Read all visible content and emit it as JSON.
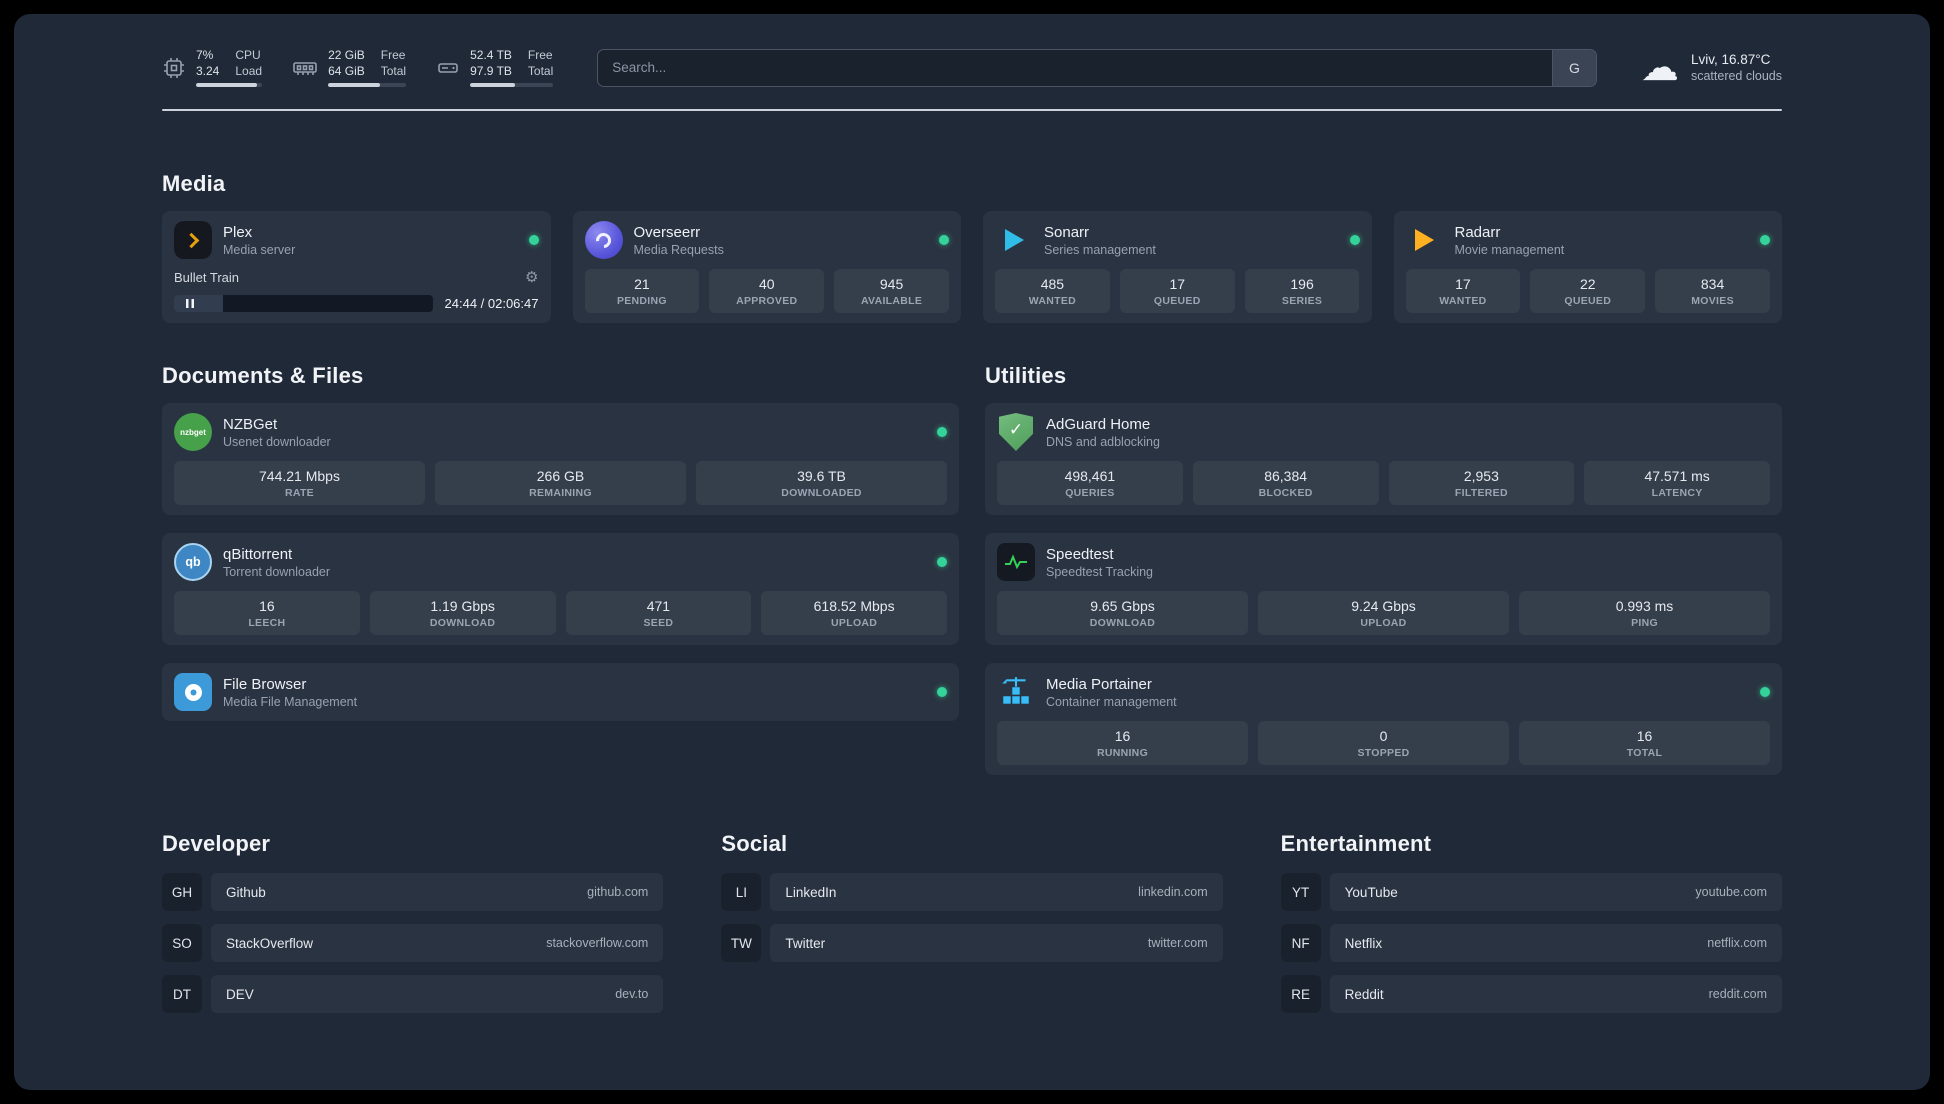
{
  "colors": {
    "background": "#1f2937",
    "card": "rgba(255,255,255,0.05)",
    "status_online": "#34d399",
    "accent_plex": "#e5a00d",
    "accent_sonarr": "#2fbde8",
    "accent_radarr": "#ffb020",
    "accent_adguard": "#4e9d5b",
    "accent_portainer": "#38bdf8",
    "accent_speedtest": "#34d058"
  },
  "icons": [
    "cpu-icon",
    "memory-icon",
    "disk-icon",
    "cloud-icon",
    "gear-icon",
    "pause-icon",
    "plex-icon",
    "overseerr-icon",
    "sonarr-icon",
    "radarr-icon",
    "nzbget-icon",
    "qbittorrent-icon",
    "filebrowser-icon",
    "adguard-shield-icon",
    "speedtest-icon",
    "portainer-icon"
  ],
  "topbar": {
    "resources": [
      {
        "icon": "cpu-icon",
        "col1_top": "7%",
        "col1_bottom": "3.24",
        "col2_top": "CPU",
        "col2_bottom": "Load",
        "progress": 93
      },
      {
        "icon": "memory-icon",
        "col1_top": "22 GiB",
        "col1_bottom": "64 GiB",
        "col2_top": "Free",
        "col2_bottom": "Total",
        "progress": 66
      },
      {
        "icon": "disk-icon",
        "col1_top": "52.4 TB",
        "col1_bottom": "97.9 TB",
        "col2_top": "Free",
        "col2_bottom": "Total",
        "progress": 54
      }
    ],
    "search": {
      "placeholder": "Search...",
      "provider_label": "G"
    },
    "weather": {
      "location": "Lviv, 16.87°C",
      "condition": "scattered clouds"
    }
  },
  "media": {
    "title": "Media",
    "plex": {
      "name": "Plex",
      "subtitle": "Media server",
      "track": "Bullet Train",
      "time": "24:44 / 02:06:47",
      "progress": 19
    },
    "overseerr": {
      "name": "Overseerr",
      "subtitle": "Media Requests",
      "stats": [
        {
          "value": "21",
          "label": "PENDING"
        },
        {
          "value": "40",
          "label": "APPROVED"
        },
        {
          "value": "945",
          "label": "AVAILABLE"
        }
      ]
    },
    "sonarr": {
      "name": "Sonarr",
      "subtitle": "Series management",
      "stats": [
        {
          "value": "485",
          "label": "WANTED"
        },
        {
          "value": "17",
          "label": "QUEUED"
        },
        {
          "value": "196",
          "label": "SERIES"
        }
      ]
    },
    "radarr": {
      "name": "Radarr",
      "subtitle": "Movie management",
      "stats": [
        {
          "value": "17",
          "label": "WANTED"
        },
        {
          "value": "22",
          "label": "QUEUED"
        },
        {
          "value": "834",
          "label": "MOVIES"
        }
      ]
    }
  },
  "documents": {
    "title": "Documents & Files",
    "nzbget": {
      "name": "NZBGet",
      "subtitle": "Usenet downloader",
      "icon_text": "nzbget",
      "stats": [
        {
          "value": "744.21 Mbps",
          "label": "RATE"
        },
        {
          "value": "266 GB",
          "label": "REMAINING"
        },
        {
          "value": "39.6 TB",
          "label": "DOWNLOADED"
        }
      ]
    },
    "qbittorrent": {
      "name": "qBittorrent",
      "subtitle": "Torrent downloader",
      "icon_text": "qb",
      "stats": [
        {
          "value": "16",
          "label": "LEECH"
        },
        {
          "value": "1.19 Gbps",
          "label": "DOWNLOAD"
        },
        {
          "value": "471",
          "label": "SEED"
        },
        {
          "value": "618.52 Mbps",
          "label": "UPLOAD"
        }
      ]
    },
    "filebrowser": {
      "name": "File Browser",
      "subtitle": "Media File Management"
    }
  },
  "utilities": {
    "title": "Utilities",
    "adguard": {
      "name": "AdGuard Home",
      "subtitle": "DNS and adblocking",
      "stats": [
        {
          "value": "498,461",
          "label": "QUERIES"
        },
        {
          "value": "86,384",
          "label": "BLOCKED"
        },
        {
          "value": "2,953",
          "label": "FILTERED"
        },
        {
          "value": "47.571 ms",
          "label": "LATENCY"
        }
      ]
    },
    "speedtest": {
      "name": "Speedtest",
      "subtitle": "Speedtest Tracking",
      "stats": [
        {
          "value": "9.65 Gbps",
          "label": "DOWNLOAD"
        },
        {
          "value": "9.24 Gbps",
          "label": "UPLOAD"
        },
        {
          "value": "0.993 ms",
          "label": "PING"
        }
      ]
    },
    "portainer": {
      "name": "Media Portainer",
      "subtitle": "Container management",
      "stats": [
        {
          "value": "16",
          "label": "RUNNING"
        },
        {
          "value": "0",
          "label": "STOPPED"
        },
        {
          "value": "16",
          "label": "TOTAL"
        }
      ]
    }
  },
  "bookmarks": [
    {
      "title": "Developer",
      "links": [
        {
          "abbr": "GH",
          "name": "Github",
          "url": "github.com"
        },
        {
          "abbr": "SO",
          "name": "StackOverflow",
          "url": "stackoverflow.com"
        },
        {
          "abbr": "DT",
          "name": "DEV",
          "url": "dev.to"
        }
      ]
    },
    {
      "title": "Social",
      "links": [
        {
          "abbr": "LI",
          "name": "LinkedIn",
          "url": "linkedin.com"
        },
        {
          "abbr": "TW",
          "name": "Twitter",
          "url": "twitter.com"
        }
      ]
    },
    {
      "title": "Entertainment",
      "links": [
        {
          "abbr": "YT",
          "name": "YouTube",
          "url": "youtube.com"
        },
        {
          "abbr": "NF",
          "name": "Netflix",
          "url": "netflix.com"
        },
        {
          "abbr": "RE",
          "name": "Reddit",
          "url": "reddit.com"
        }
      ]
    }
  ]
}
